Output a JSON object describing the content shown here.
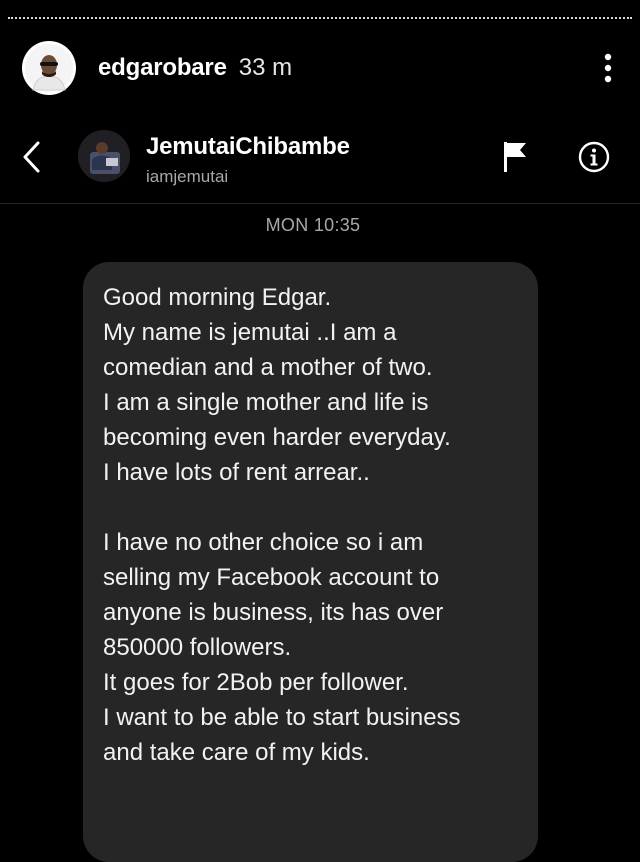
{
  "story": {
    "username": "edgarobare",
    "time": "33 m"
  },
  "chat": {
    "contact_name": "JemutaiChibambe",
    "contact_handle": "iamjemutai",
    "timestamp": "MON 10:35"
  },
  "message": {
    "lines": [
      "Good morning Edgar.",
      "My name is jemutai ..I am a",
      "comedian and a mother of two.",
      "I am a single mother and life is",
      "becoming even harder everyday.",
      "I have lots of rent arrear..",
      "",
      "I have no other choice so i am",
      "selling my Facebook account to",
      "anyone is business, its has over",
      "850000 followers.",
      "It goes for 2Bob per follower.",
      "I want to be able to start business",
      "and take care of my kids."
    ]
  },
  "icons": {
    "more": "more-vertical-icon",
    "back": "chevron-left-icon",
    "flag": "flag-icon",
    "info": "info-icon"
  },
  "colors": {
    "background": "#000000",
    "bubble": "#262626",
    "secondary_text": "#a8a8a8"
  }
}
